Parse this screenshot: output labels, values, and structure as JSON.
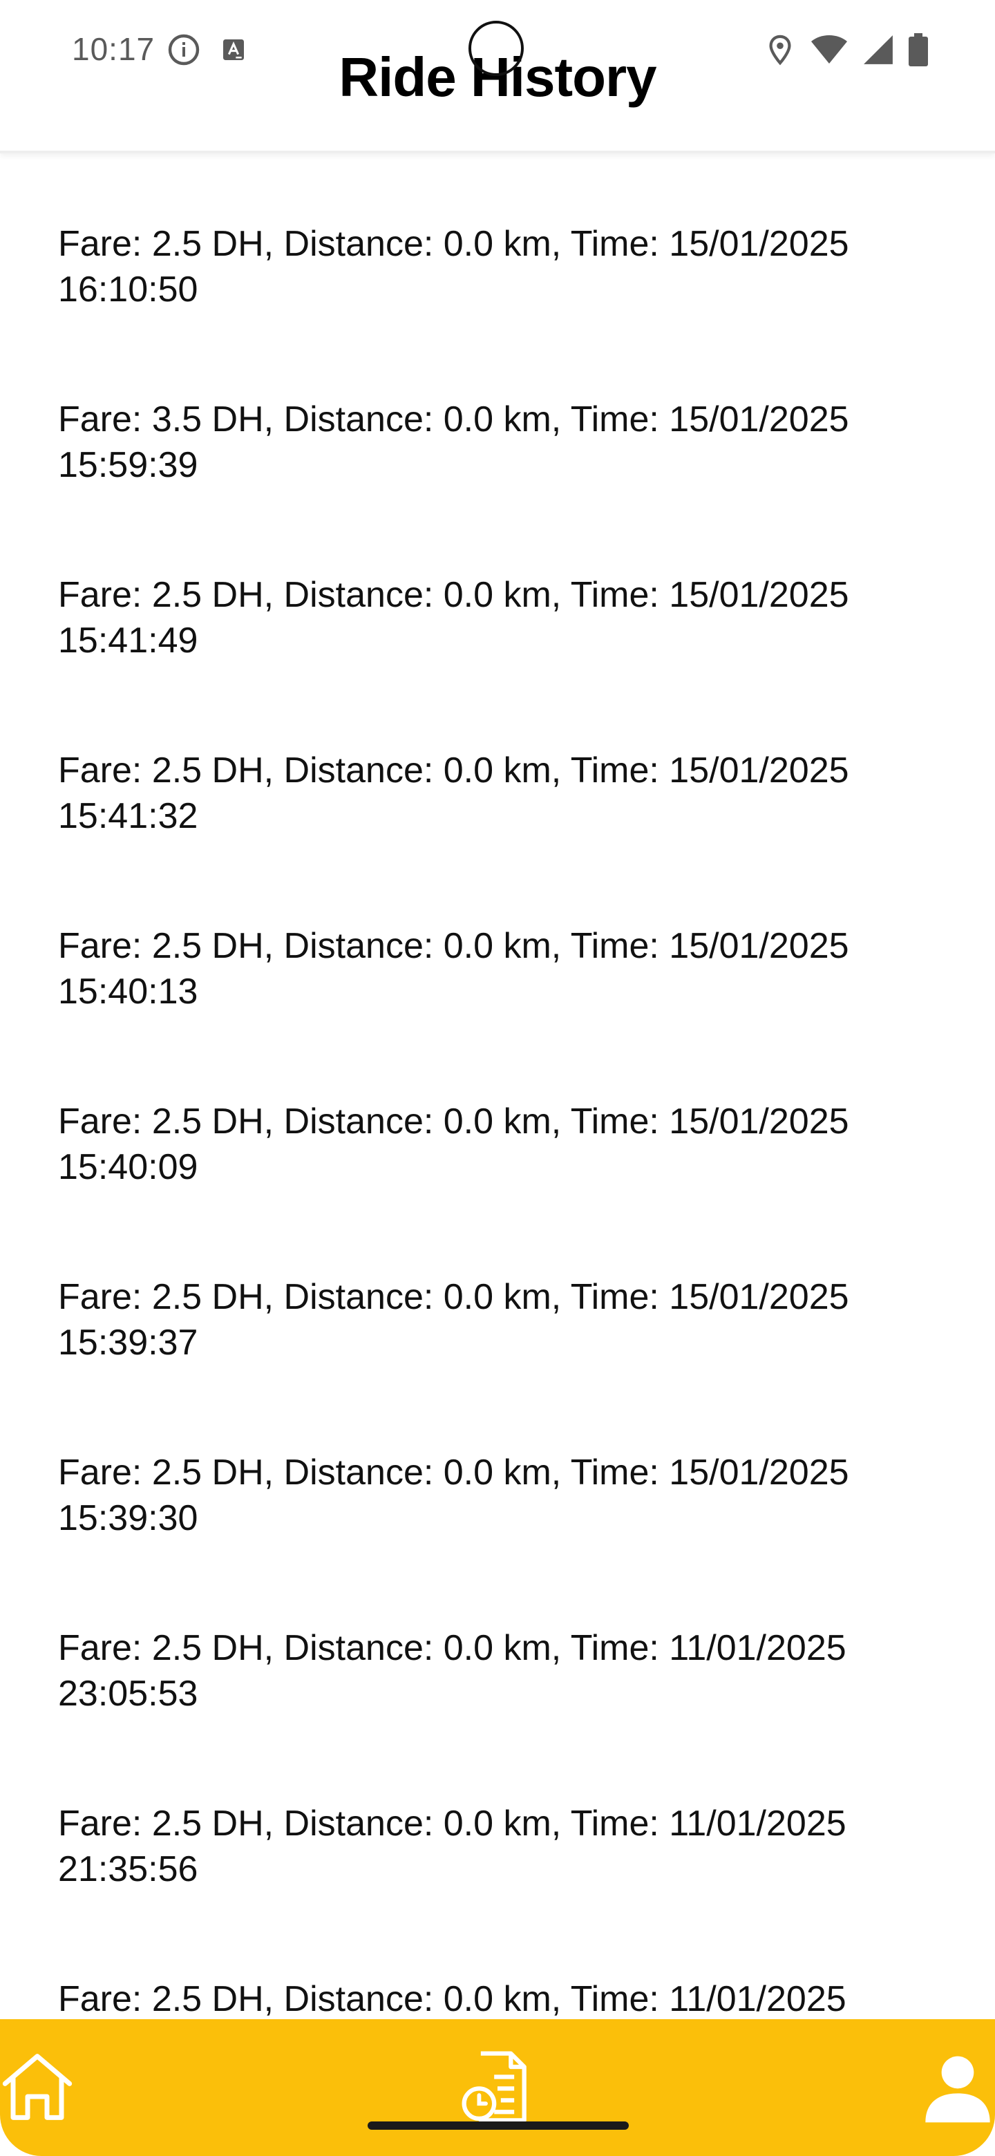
{
  "status_bar": {
    "time": "10:17",
    "left_icons": [
      "info-icon",
      "text-recognition-icon"
    ],
    "right_icons": [
      "location-icon",
      "wifi-icon",
      "signal-icon",
      "battery-icon"
    ]
  },
  "header": {
    "title": "Ride History"
  },
  "rides": [
    {
      "line1": "Fare: 2.5 DH, Distance: 0.0 km, Time: 15/01/2025",
      "line2": "16:10:50"
    },
    {
      "line1": "Fare: 3.5 DH, Distance: 0.0 km, Time: 15/01/2025",
      "line2": "15:59:39"
    },
    {
      "line1": "Fare: 2.5 DH, Distance: 0.0 km, Time: 15/01/2025",
      "line2": "15:41:49"
    },
    {
      "line1": "Fare: 2.5 DH, Distance: 0.0 km, Time: 15/01/2025",
      "line2": "15:41:32"
    },
    {
      "line1": "Fare: 2.5 DH, Distance: 0.0 km, Time: 15/01/2025",
      "line2": "15:40:13"
    },
    {
      "line1": "Fare: 2.5 DH, Distance: 0.0 km, Time: 15/01/2025",
      "line2": "15:40:09"
    },
    {
      "line1": "Fare: 2.5 DH, Distance: 0.0 km, Time: 15/01/2025",
      "line2": "15:39:37"
    },
    {
      "line1": "Fare: 2.5 DH, Distance: 0.0 km, Time: 15/01/2025",
      "line2": "15:39:30"
    },
    {
      "line1": "Fare: 2.5 DH, Distance: 0.0 km, Time: 11/01/2025",
      "line2": "23:05:53"
    },
    {
      "line1": "Fare: 2.5 DH, Distance: 0.0 km, Time: 11/01/2025",
      "line2": "21:35:56"
    },
    {
      "line1": "Fare: 2.5 DH, Distance: 0.0 km, Time: 11/01/2025",
      "line2": ""
    }
  ],
  "bottom_nav": {
    "background": "#fbbf0a",
    "items": [
      {
        "icon": "home-icon"
      },
      {
        "icon": "history-icon"
      },
      {
        "icon": "profile-icon"
      }
    ]
  }
}
